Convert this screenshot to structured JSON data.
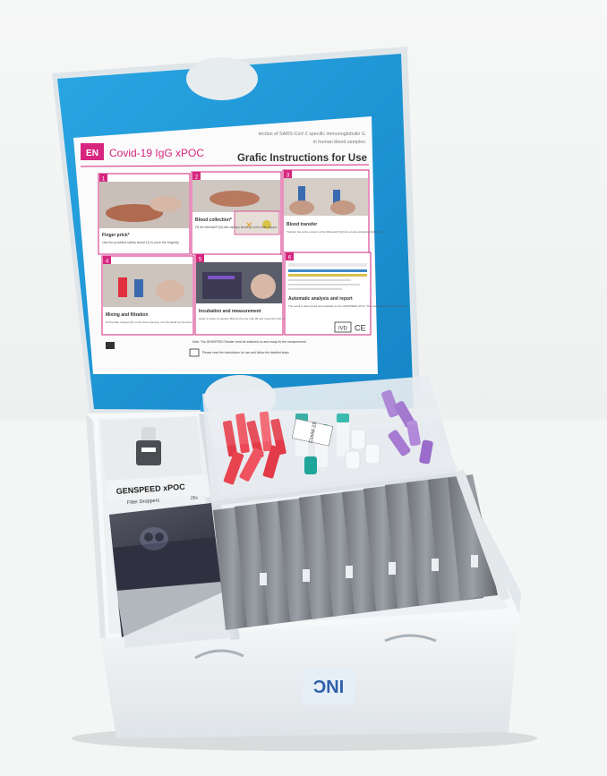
{
  "card": {
    "lang_badge": "EN",
    "product_title": "Covid-19 IgG xPOC",
    "subtitle_line1": "tection of SARS-CoV-2 specific immunoglobulin G",
    "subtitle_line2": "in human blood samples",
    "heading": "Grafic Instructions for Use",
    "steps": [
      {
        "num": "1",
        "title": "Finger prick*",
        "body": "Use the provided safety lancet [1] to prick the fingertip"
      },
      {
        "num": "2",
        "title": "Blood collection*",
        "body": "Fill the Minivette® [M] with capillary blood up to the white stopper"
      },
      {
        "num": "3",
        "title": "Blood transfer",
        "body": "Transfer the entire content of the Minivette® [M] into a tube containing buffer A [A]"
      },
      {
        "num": "4",
        "title": "Mixing and filtration",
        "body": "Fit the filter dropper [F] on the tube opening, mix the liquid by inversion"
      },
      {
        "num": "5",
        "title": "Incubation and measurement",
        "body": "Apply 2 drops of solution [B] into the test chip [5] and insert the chip for measurement"
      },
      {
        "num": "6",
        "title": "Automatic analysis and report",
        "body": "The result is determined automatically by the GENSPEED xPOC. The results appear on the screen"
      }
    ],
    "footer_note": "Note: The GENSPEED Reader must be switched on and ready for the measurement",
    "footer_note2": "Please read the instructions for use and follow the labelled steps",
    "ivd_mark": "IVD",
    "ce_mark": "CE"
  },
  "kit": {
    "dropper_bag_label": "GENSPEED xPOC",
    "dropper_bag_sublabel": "Filter Droppers",
    "dropper_bag_count": "25x",
    "tube_bag_label": "Covid-19"
  },
  "box": {
    "side_label": "INC"
  },
  "colors": {
    "box_blue": "#1f9ad8",
    "accent_magenta": "#d6267f",
    "box_white": "#eef1f3"
  }
}
